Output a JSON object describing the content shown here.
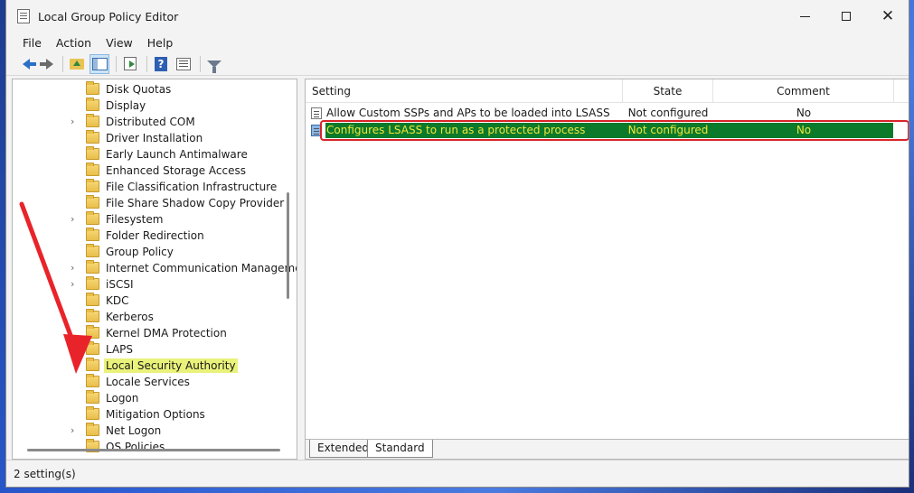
{
  "window": {
    "title": "Local Group Policy Editor"
  },
  "menu": [
    "File",
    "Action",
    "View",
    "Help"
  ],
  "tree": {
    "items": [
      {
        "label": "Disk Quotas",
        "expandable": false
      },
      {
        "label": "Display",
        "expandable": false
      },
      {
        "label": "Distributed COM",
        "expandable": true
      },
      {
        "label": "Driver Installation",
        "expandable": false
      },
      {
        "label": "Early Launch Antimalware",
        "expandable": false
      },
      {
        "label": "Enhanced Storage Access",
        "expandable": false
      },
      {
        "label": "File Classification Infrastructure",
        "expandable": false
      },
      {
        "label": "File Share Shadow Copy Provider",
        "expandable": false
      },
      {
        "label": "Filesystem",
        "expandable": true
      },
      {
        "label": "Folder Redirection",
        "expandable": false
      },
      {
        "label": "Group Policy",
        "expandable": false
      },
      {
        "label": "Internet Communication Manageme",
        "expandable": true
      },
      {
        "label": "iSCSI",
        "expandable": true
      },
      {
        "label": "KDC",
        "expandable": false
      },
      {
        "label": "Kerberos",
        "expandable": false
      },
      {
        "label": "Kernel DMA Protection",
        "expandable": false
      },
      {
        "label": "LAPS",
        "expandable": false
      },
      {
        "label": "Local Security Authority",
        "expandable": false,
        "selected": true
      },
      {
        "label": "Locale Services",
        "expandable": false
      },
      {
        "label": "Logon",
        "expandable": false
      },
      {
        "label": "Mitigation Options",
        "expandable": false
      },
      {
        "label": "Net Logon",
        "expandable": true
      },
      {
        "label": "OS Policies",
        "expandable": false
      }
    ]
  },
  "list": {
    "columns": {
      "setting": "Setting",
      "state": "State",
      "comment": "Comment"
    },
    "rows": [
      {
        "setting": "Allow Custom SSPs and APs to be loaded into LSASS",
        "state": "Not configured",
        "comment": "No"
      },
      {
        "setting": "Configures LSASS to run as a protected process",
        "state": "Not configured",
        "comment": "No",
        "selected": true
      }
    ]
  },
  "tabs": {
    "extended": "Extended",
    "standard": "Standard"
  },
  "status": {
    "text": "2 setting(s)"
  },
  "colors": {
    "selection_bg": "#0c7a2b",
    "selection_text": "#f0e63a",
    "highlight_box": "#d9242a",
    "tree_highlight": "#e9f27a",
    "annotation_arrow": "#e8242a"
  }
}
